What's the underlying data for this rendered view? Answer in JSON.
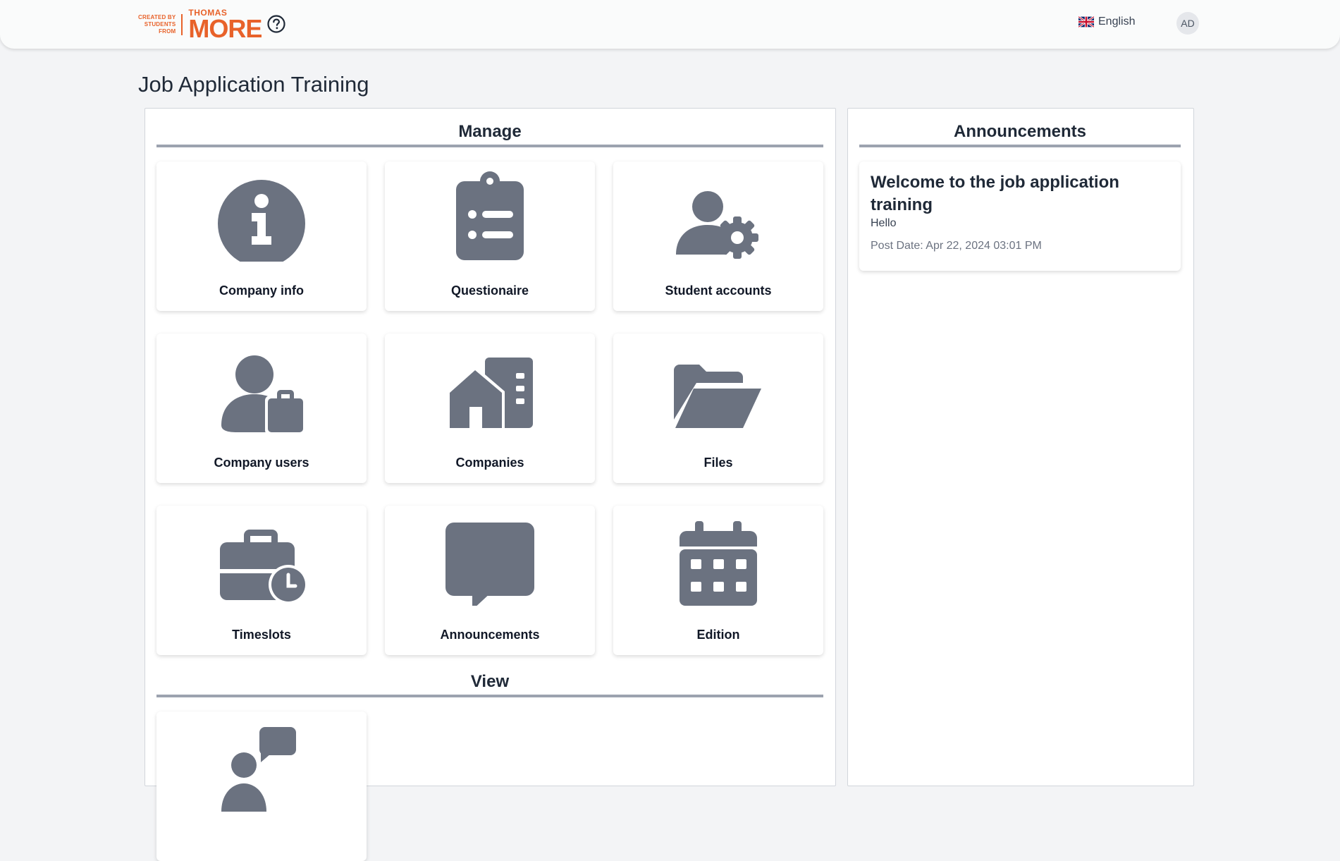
{
  "header": {
    "logo_small": [
      "CREATED BY",
      "STUDENTS",
      "FROM"
    ],
    "logo_top": "THOMAS",
    "logo_main": "MORE",
    "help_icon": "question-circle-icon",
    "language": "English",
    "avatar": "AD"
  },
  "page": {
    "title": "Job Application Training"
  },
  "manage": {
    "heading": "Manage",
    "cards": [
      {
        "label": "Company info",
        "icon": "info-circle-icon"
      },
      {
        "label": "Questionaire",
        "icon": "clipboard-list-icon"
      },
      {
        "label": "Student accounts",
        "icon": "user-gear-icon"
      },
      {
        "label": "Company users",
        "icon": "user-briefcase-icon"
      },
      {
        "label": "Companies",
        "icon": "house-building-icon"
      },
      {
        "label": "Files",
        "icon": "folder-open-icon"
      },
      {
        "label": "Timeslots",
        "icon": "briefcase-clock-icon"
      },
      {
        "label": "Announcements",
        "icon": "message-icon"
      },
      {
        "label": "Edition",
        "icon": "calendar-icon"
      }
    ]
  },
  "view": {
    "heading": "View",
    "cards": [
      {
        "label": "",
        "icon": "user-comment-icon"
      }
    ]
  },
  "announcements": {
    "heading": "Announcements",
    "items": [
      {
        "title": "Welcome to the job application training",
        "body": "Hello",
        "date": "Post Date: Apr 22, 2024 03:01 PM"
      }
    ]
  },
  "colors": {
    "icon": "#6b7280",
    "brand": "#e8622a",
    "divider": "#9ca3af"
  }
}
